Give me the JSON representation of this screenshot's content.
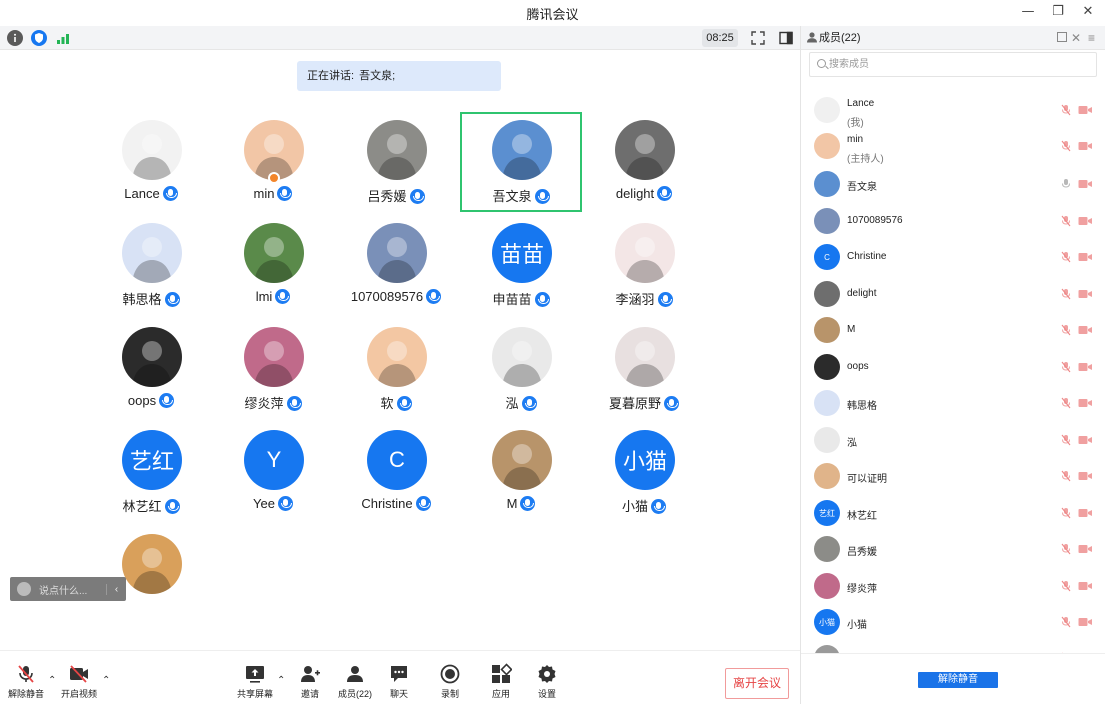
{
  "window": {
    "title": "腾讯会议",
    "controls": [
      "minimize-icon",
      "restore-icon",
      "close-icon"
    ]
  },
  "infobar": {
    "timer": "08:25",
    "icons": [
      "info-icon",
      "shield-icon",
      "signal-icon",
      "fullscreen-icon",
      "side-panel-icon"
    ]
  },
  "speaking": {
    "prefix": "正在讲话:",
    "name": "吾文泉;"
  },
  "grid": {
    "tiles": [
      {
        "name": "Lance",
        "avatar": "cartoon-glasses-avatar",
        "bg": "#f2f2f2",
        "active": false,
        "host": false
      },
      {
        "name": "min",
        "avatar": "bear-avatar",
        "bg": "#f2c6a6",
        "active": false,
        "host": true
      },
      {
        "name": "吕秀媛",
        "avatar": "girl-hat-avatar",
        "bg": "#8c8c88",
        "active": false,
        "host": false
      },
      {
        "name": "吾文泉",
        "avatar": "grassland-avatar",
        "bg": "#5b8fd0",
        "active": true,
        "host": false
      },
      {
        "name": "delight",
        "avatar": "building-avatar",
        "bg": "#6e6e6e",
        "active": false,
        "host": false
      },
      {
        "name": "韩思格",
        "avatar": "cow-cartoon-avatar",
        "bg": "#d8e2f5",
        "active": false,
        "host": false
      },
      {
        "name": "lmi",
        "avatar": "field-people-avatar",
        "bg": "#5a8a4a",
        "active": false,
        "host": false
      },
      {
        "name": "1070089576",
        "avatar": "girl-photo-avatar",
        "bg": "#7a90b8",
        "active": false,
        "host": false
      },
      {
        "name": "申苗苗",
        "avatar_text": "苗苗",
        "bg": "#1677f0",
        "active": false,
        "host": false
      },
      {
        "name": "李涵羽",
        "avatar": "sheep-cartoon-avatar",
        "bg": "#f3e6e6",
        "active": false,
        "host": false
      },
      {
        "name": "oops",
        "avatar": "girl-white-avatar",
        "bg": "#2b2b2b",
        "active": false,
        "host": false
      },
      {
        "name": "缪炎萍",
        "avatar": "pink-girl-avatar",
        "bg": "#c06a8a",
        "active": false,
        "host": false
      },
      {
        "name": "软",
        "avatar": "camera-cartoon-avatar",
        "bg": "#f3c7a3",
        "active": false,
        "host": false
      },
      {
        "name": "泓",
        "avatar": "dark-hair-avatar",
        "bg": "#e9e9e9",
        "active": false,
        "host": false
      },
      {
        "name": "夏暮原野",
        "avatar": "anime-girl-avatar",
        "bg": "#e8e0e0",
        "active": false,
        "host": false
      },
      {
        "name": "林艺红",
        "avatar_text": "艺红",
        "bg": "#1677f0",
        "active": false,
        "host": false
      },
      {
        "name": "Yee",
        "avatar_text": "Y",
        "bg": "#1677f0",
        "active": false,
        "host": false
      },
      {
        "name": "Christine",
        "avatar_text": "C",
        "bg": "#1677f0",
        "active": false,
        "host": false
      },
      {
        "name": "M",
        "avatar": "alpaca-avatar",
        "bg": "#b8946a",
        "active": false,
        "host": false
      },
      {
        "name": "小猫",
        "avatar_text": "小猫",
        "bg": "#1677f0",
        "active": false,
        "host": false
      },
      {
        "name": "",
        "avatar": "tiger-avatar",
        "bg": "#d9a05b",
        "active": false,
        "host": false
      }
    ]
  },
  "chat": {
    "placeholder": "说点什么...",
    "collapse": "‹"
  },
  "toolbar": {
    "unmute": "解除静音",
    "video": "开启视频",
    "share": "共享屏幕",
    "invite": "邀请",
    "members": "成员(22)",
    "chat": "聊天",
    "record": "录制",
    "apps": "应用",
    "settings": "设置",
    "leave": "离开会议"
  },
  "panel": {
    "title": "成员(22)",
    "search_placeholder": "搜索成员",
    "unmute_all": "解除静音",
    "members": [
      {
        "name": "Lance",
        "role": "(我)",
        "bg": "#f0f0f0",
        "mic": "muted"
      },
      {
        "name": "min",
        "role": "(主持人)",
        "bg": "#f2c6a6",
        "mic": "muted"
      },
      {
        "name": "吾文泉",
        "role": "",
        "bg": "#5b8fd0",
        "mic": "on"
      },
      {
        "name": "1070089576",
        "role": "",
        "bg": "#7a90b8",
        "mic": "muted"
      },
      {
        "name": "Christine",
        "role": "",
        "bg": "#1677f0",
        "text": "C",
        "mic": "muted"
      },
      {
        "name": "delight",
        "role": "",
        "bg": "#6e6e6e",
        "mic": "muted"
      },
      {
        "name": "M",
        "role": "",
        "bg": "#b8946a",
        "mic": "muted"
      },
      {
        "name": "oops",
        "role": "",
        "bg": "#2b2b2b",
        "mic": "muted"
      },
      {
        "name": "韩思格",
        "role": "",
        "bg": "#d8e2f5",
        "mic": "muted"
      },
      {
        "name": "泓",
        "role": "",
        "bg": "#e9e9e9",
        "mic": "muted"
      },
      {
        "name": "可以证明",
        "role": "",
        "bg": "#e0b48a",
        "mic": "muted"
      },
      {
        "name": "林艺红",
        "role": "",
        "bg": "#1677f0",
        "text": "艺红",
        "mic": "muted"
      },
      {
        "name": "吕秀媛",
        "role": "",
        "bg": "#8c8c88",
        "mic": "muted"
      },
      {
        "name": "缪炎萍",
        "role": "",
        "bg": "#c06a8a",
        "mic": "muted"
      },
      {
        "name": "小猫",
        "role": "",
        "bg": "#1677f0",
        "text": "小猫",
        "mic": "muted"
      },
      {
        "name": "",
        "role": "",
        "bg": "#9a9a9a",
        "mic": "muted"
      }
    ]
  },
  "colors": {
    "accent": "#1677f0",
    "active_border": "#2fc46f",
    "leave": "#e64545",
    "muted_red": "#f0a0a0"
  }
}
